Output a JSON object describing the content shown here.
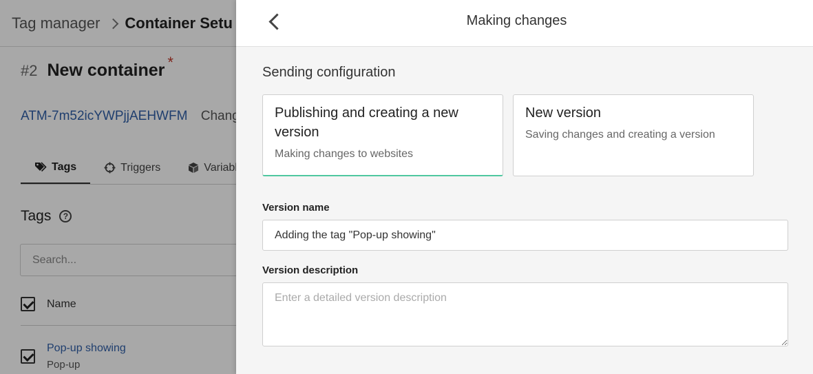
{
  "breadcrumb": {
    "root": "Tag manager",
    "current": "Container Setu"
  },
  "container": {
    "number": "#2",
    "name": "New container",
    "required_mark": "*",
    "id": "ATM-7m52icYWPjjAEHWFM",
    "extra_text": "Chang"
  },
  "tabs": [
    {
      "label": "Tags",
      "icon": "tags-icon"
    },
    {
      "label": "Triggers",
      "icon": "crosshair-icon"
    },
    {
      "label": "Variabl",
      "icon": "cube-icon"
    }
  ],
  "tags_section": {
    "heading": "Tags",
    "help_glyph": "?",
    "search_placeholder": "Search...",
    "column_name": "Name",
    "rows": [
      {
        "name": "Pop-up showing",
        "type": "Pop-up",
        "checked": true
      }
    ]
  },
  "drawer": {
    "title": "Making changes",
    "section_title": "Sending configuration",
    "options": [
      {
        "title": "Publishing and creating a new version",
        "description": "Making changes to websites",
        "selected": true
      },
      {
        "title": "New version",
        "description": "Saving changes and creating a version",
        "selected": false
      }
    ],
    "version_name_label": "Version name",
    "version_name_value": "Adding the tag \"Pop-up showing\"",
    "version_description_label": "Version description",
    "version_description_placeholder": "Enter a detailed version description"
  },
  "colors": {
    "link": "#2f5fa8",
    "selected_accent": "#4fc7a0",
    "overlay": "rgba(0,0,0,0.34)"
  }
}
